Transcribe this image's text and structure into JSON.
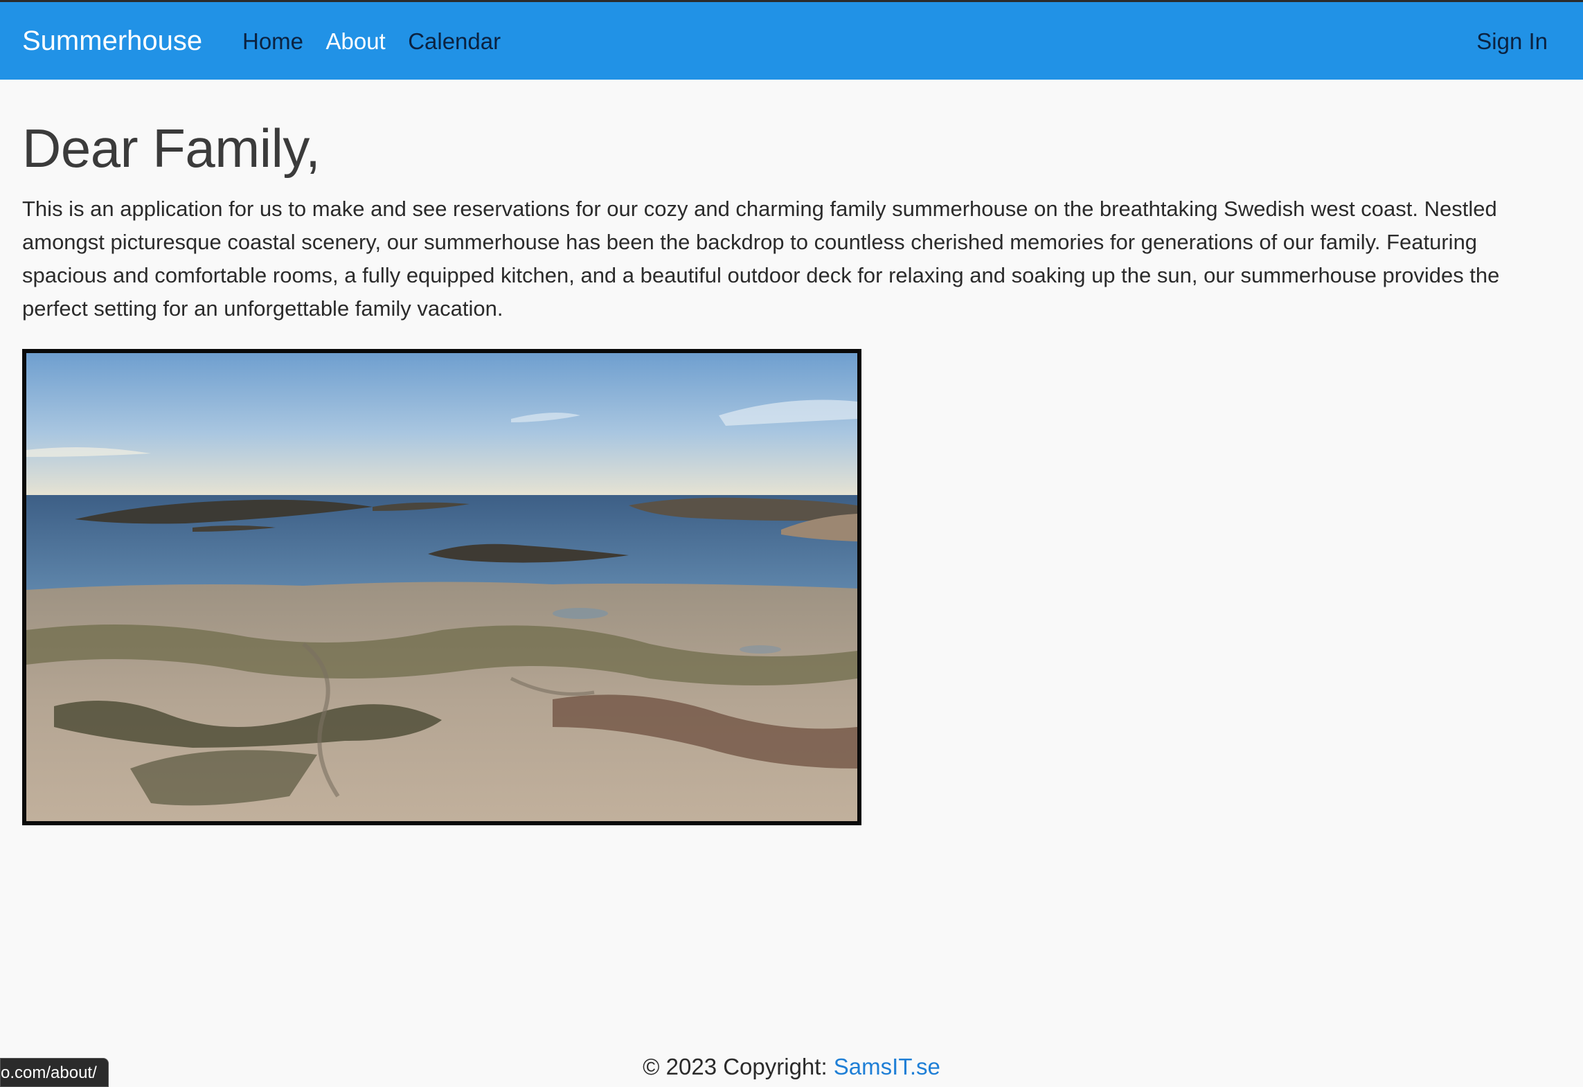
{
  "navbar": {
    "brand": "Summerhouse",
    "links": [
      "Home",
      "About",
      "Calendar"
    ],
    "signin": "Sign In",
    "color": "#2192e6"
  },
  "main": {
    "heading": "Dear Family,",
    "intro": "This is an application for us to make and see reservations for our cozy and charming family summerhouse on the breathtaking Swedish west coast. Nestled amongst picturesque coastal scenery, our summerhouse has been the backdrop to countless cherished memories for generations of our family. Featuring spacious and comfortable rooms, a fully equipped kitchen, and a beautiful outdoor deck for relaxing and soaking up the sun, our summerhouse provides the perfect setting for an unforgettable family vacation."
  },
  "footer": {
    "copyright": "© 2023 Copyright: ",
    "link": "SamsIT.se"
  },
  "status_bar": {
    "url": "o.com/about/"
  }
}
